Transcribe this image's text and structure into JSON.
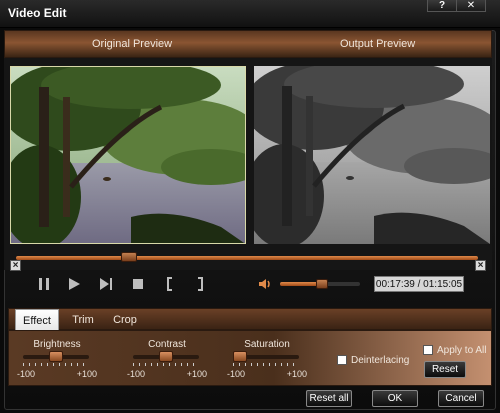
{
  "window": {
    "title": "Video Edit",
    "help_label": "?",
    "close_label": "✕"
  },
  "preview": {
    "original_label": "Original Preview",
    "output_label": "Output Preview"
  },
  "playback": {
    "timecode": "00:17:39 / 01:15:05",
    "seek_position": 0.245,
    "volume_level": 0.52,
    "trim_start_marker": "×",
    "trim_end_marker": "×"
  },
  "icons": [
    "pause-icon",
    "play-icon",
    "next-frame-icon",
    "stop-icon",
    "mark-in-icon",
    "mark-out-icon",
    "volume-icon"
  ],
  "tabs": [
    {
      "label": "Effect",
      "active": true
    },
    {
      "label": "Trim",
      "active": false
    },
    {
      "label": "Crop",
      "active": false
    }
  ],
  "effect": {
    "brightness": {
      "label": "Brightness",
      "min": "-100",
      "max": "+100",
      "value": 0
    },
    "contrast": {
      "label": "Contrast",
      "min": "-100",
      "max": "+100",
      "value": 0
    },
    "saturation": {
      "label": "Saturation",
      "min": "-100",
      "max": "+100",
      "value": -100
    },
    "deinterlacing_label": "Deinterlacing",
    "deinterlacing_checked": false,
    "apply_to_all_label": "Apply to All",
    "apply_to_all_checked": false,
    "reset_label": "Reset"
  },
  "footer": {
    "reset_all_label": "Reset all",
    "ok_label": "OK",
    "cancel_label": "Cancel"
  },
  "colors": {
    "accent": "#c0703a",
    "panel": "#4a2f1c"
  }
}
